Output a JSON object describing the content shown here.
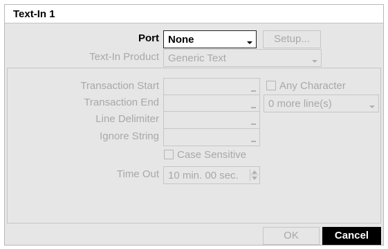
{
  "dialog": {
    "title": "Text-In 1"
  },
  "port": {
    "label": "Port",
    "value": "None",
    "setup_button": "Setup..."
  },
  "product": {
    "label": "Text-In Product",
    "value": "Generic Text"
  },
  "transaction_start": {
    "label": "Transaction Start",
    "value": "",
    "any_character_label": "Any Character",
    "any_character_checked": false
  },
  "transaction_end": {
    "label": "Transaction End",
    "value": "",
    "more_lines_value": "0 more line(s)"
  },
  "line_delimiter": {
    "label": "Line Delimiter",
    "value": ""
  },
  "ignore_string": {
    "label": "Ignore String",
    "value": ""
  },
  "case_sensitive": {
    "label": "Case Sensitive",
    "checked": false
  },
  "time_out": {
    "label": "Time Out",
    "value": "10 min. 00 sec."
  },
  "footer": {
    "ok_label": "OK",
    "cancel_label": "Cancel"
  }
}
